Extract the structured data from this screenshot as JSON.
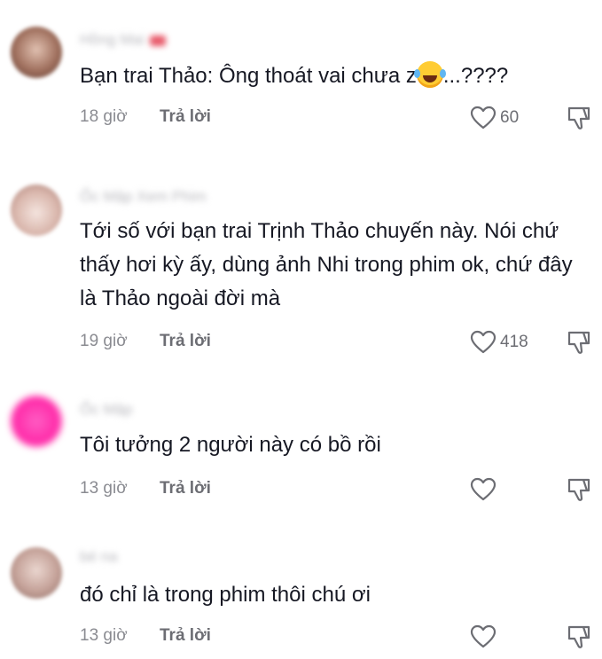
{
  "comments": [
    {
      "username": "Hồng Mai",
      "has_badge": true,
      "avatar_color": "#b08070",
      "text_parts": [
        "Bạn trai Thảo: Ông thoát vai chưa z",
        "...????"
      ],
      "has_emoji": true,
      "emoji": "face-with-tears-of-joy-icon",
      "time": "18 giờ",
      "reply": "Trả lời",
      "likes": "60"
    },
    {
      "username": "Ốc Mập Xem Phim",
      "has_badge": false,
      "avatar_color": "#d8b8b0",
      "text_parts": [
        "Tới số với bạn trai Trịnh Thảo chuyến này. Nói chứ thấy hơi kỳ ấy, dùng ảnh Nhi trong phim ok, chứ đây là Thảo ngoài đời mà"
      ],
      "has_emoji": false,
      "time": "19 giờ",
      "reply": "Trả lời",
      "likes": "418"
    },
    {
      "username": "Ốc Mập",
      "has_badge": false,
      "avatar_color": "#ff3fb4",
      "text_parts": [
        "Tôi tưởng 2 người này có bồ rồi"
      ],
      "has_emoji": false,
      "time": "13 giờ",
      "reply": "Trả lời",
      "likes": ""
    },
    {
      "username": "bé na",
      "has_badge": false,
      "avatar_color": "#c9a9a0",
      "text_parts": [
        "đó chỉ là trong phim thôi chú ơi"
      ],
      "has_emoji": false,
      "time": "13 giờ",
      "reply": "Trả lời",
      "likes": ""
    }
  ],
  "colors": {
    "text": "#161823",
    "secondary": "#8a8b91",
    "reply": "#6c6d73",
    "icon": "#6c6d73"
  }
}
